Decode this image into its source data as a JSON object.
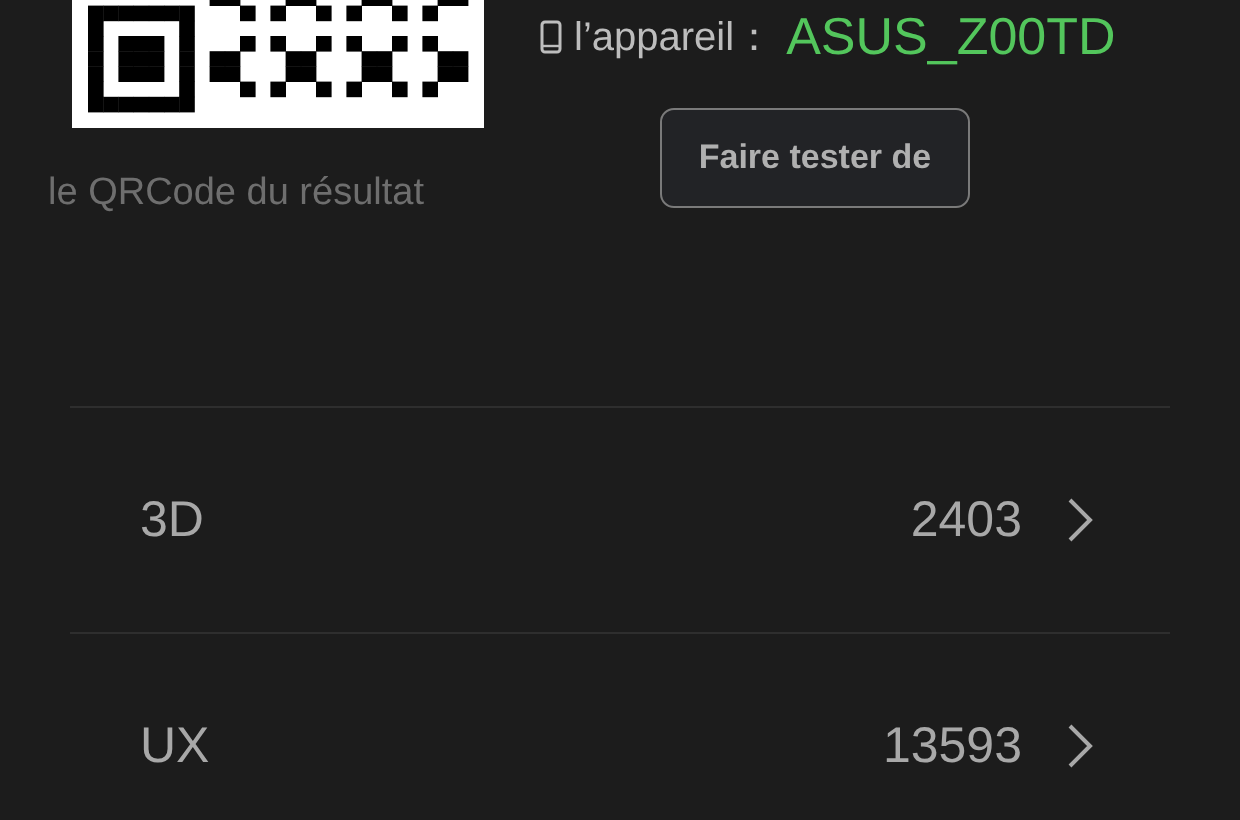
{
  "qr_code": {
    "caption": "le QRCode du résultat"
  },
  "device": {
    "label": "l’appareil：",
    "value": "ASUS_Z00TD"
  },
  "test_button": {
    "label": "Faire tester de"
  },
  "scores": [
    {
      "label": "3D",
      "value": "2403"
    },
    {
      "label": "UX",
      "value": "13593"
    }
  ]
}
